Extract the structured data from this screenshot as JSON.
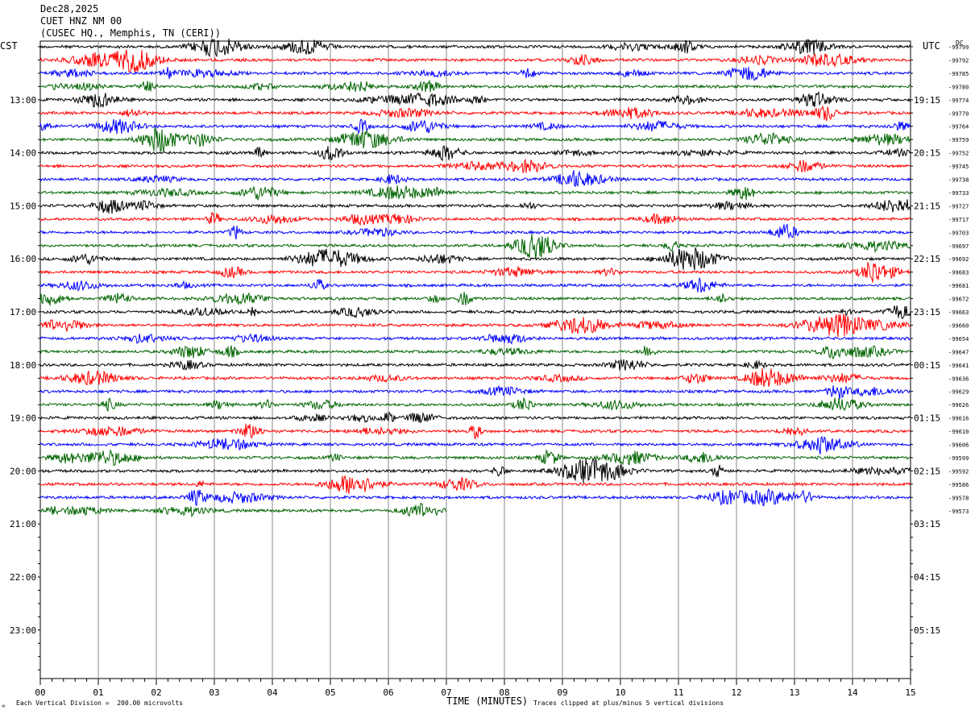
{
  "header": {
    "date": "Dec28,2025",
    "station": "CUET HNZ NM 00",
    "location": "(CUSEC HQ., Memphis, TN (CERI))"
  },
  "left_axis_title": "CST",
  "right_axis_title": "UTC",
  "dc_label": "DC",
  "footer": {
    "scale_note": "Each Vertical Division =  200.00 microvolts",
    "clip_note": "Traces clipped at plus/minus 5 vertical divisions",
    "mark": "☠"
  },
  "chart_data": {
    "type": "line",
    "xlabel": "TIME (MINUTES)",
    "xlim": [
      0,
      15
    ],
    "x_ticks": [
      "00",
      "01",
      "02",
      "03",
      "04",
      "05",
      "06",
      "07",
      "08",
      "09",
      "10",
      "11",
      "12",
      "13",
      "14",
      "15"
    ],
    "rows_per_hour": 4,
    "minutes_per_row": 15,
    "cst_hour_labels": [
      "13:00",
      "14:00",
      "15:00",
      "16:00",
      "17:00",
      "18:00",
      "19:00",
      "20:00",
      "21:00",
      "22:00",
      "23:00"
    ],
    "utc_hour_labels": [
      "19:15",
      "20:15",
      "21:15",
      "22:15",
      "23:15",
      "00:15",
      "01:15",
      "02:15",
      "03:15",
      "04:15",
      "05:15"
    ],
    "trace_colors": [
      "#000000",
      "#ff0000",
      "#0000ff",
      "#006400"
    ],
    "trace_count": 36,
    "last_trace_end_minute": 7.0,
    "dc_offsets": [
      "-99799",
      "-99792",
      "-99785",
      "-99780",
      "-99774",
      "-99770",
      "-99764",
      "-99759",
      "-99752",
      "-99745",
      "-99738",
      "-99733",
      "-99727",
      "-99717",
      "-99703",
      "-99697",
      "-99692",
      "-99683",
      "-99681",
      "-99672",
      "-99663",
      "-99660",
      "-99654",
      "-99647",
      "-99641",
      "-99636",
      "-99629",
      "-99626",
      "-99616",
      "-99610",
      "-99606",
      "-99599",
      "-99592",
      "-99586",
      "-99578",
      "-99573"
    ]
  }
}
